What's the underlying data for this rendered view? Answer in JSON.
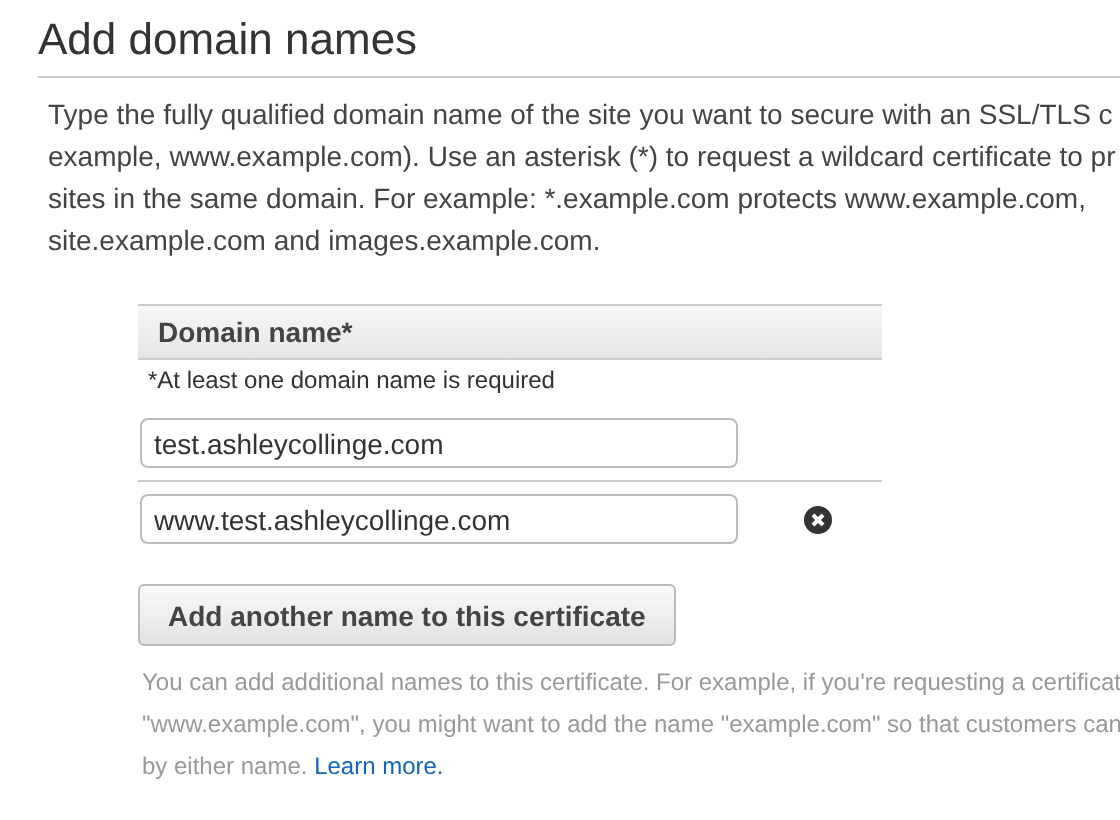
{
  "title": "Add domain names",
  "intro_lines": [
    "Type the fully qualified domain name of the site you want to secure with an SSL/TLS c",
    "example, www.example.com). Use an asterisk (*) to request a wildcard certificate to pr",
    "sites in the same domain. For example: *.example.com protects www.example.com,",
    "site.example.com and images.example.com."
  ],
  "table": {
    "header": "Domain name*",
    "note": "*At least one domain name is required",
    "rows": [
      {
        "value": "test.ashleycollinge.com",
        "removable": false
      },
      {
        "value": "www.test.ashleycollinge.com",
        "removable": true
      }
    ]
  },
  "add_button": "Add another name to this certificate",
  "help_lines": [
    "You can add additional names to this certificate. For example, if you're requesting a certificat",
    "\"www.example.com\", you might want to add the name \"example.com\" so that customers can",
    "by either name."
  ],
  "help_link": "Learn more."
}
